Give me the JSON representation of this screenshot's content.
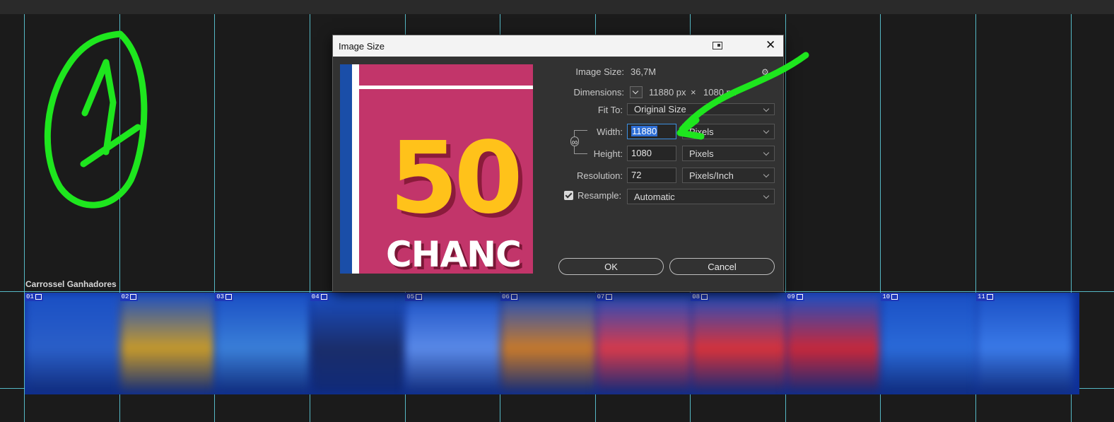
{
  "canvas": {
    "artboard_label": "Carrossel Ganhadores",
    "slides": [
      {
        "num": "01",
        "color": "#2a5fc8"
      },
      {
        "num": "02",
        "color": "#c79a2a"
      },
      {
        "num": "03",
        "color": "#3a7fd8"
      },
      {
        "num": "04",
        "color": "#1a2d6a"
      },
      {
        "num": "05",
        "color": "#5a8ae8"
      },
      {
        "num": "06",
        "color": "#c87a2a"
      },
      {
        "num": "07",
        "color": "#d83a4a"
      },
      {
        "num": "08",
        "color": "#d8323a"
      },
      {
        "num": "09",
        "color": "#c8283a"
      },
      {
        "num": "10",
        "color": "#2a6ad8"
      },
      {
        "num": "11",
        "color": "#3a7ae8"
      }
    ]
  },
  "dialog": {
    "title": "Image Size",
    "image_size_label": "Image Size:",
    "image_size_value": "36,7M",
    "dimensions_label": "Dimensions:",
    "dimensions_w": "11880 px",
    "dimensions_x": "×",
    "dimensions_h": "1080 px",
    "fit_to_label": "Fit To:",
    "fit_to_value": "Original Size",
    "width_label": "Width:",
    "width_value": "11880",
    "width_unit": "Pixels",
    "height_label": "Height:",
    "height_value": "1080",
    "height_unit": "Pixels",
    "resolution_label": "Resolution:",
    "resolution_value": "72",
    "resolution_unit": "Pixels/Inch",
    "resample_label": "Resample:",
    "resample_checked": true,
    "resample_value": "Automatic",
    "ok_label": "OK",
    "cancel_label": "Cancel",
    "preview_big_text": "50",
    "preview_word": "CHANC"
  },
  "annotation": {
    "color": "#1ee61e",
    "number_glyph": "1"
  }
}
